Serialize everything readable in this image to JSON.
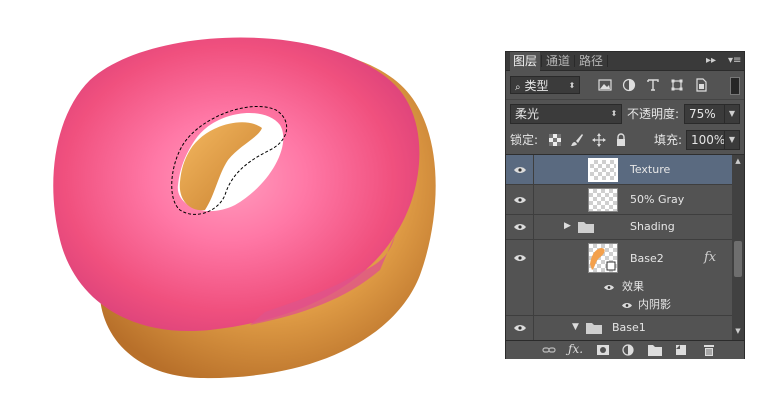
{
  "panel": {
    "tabs": [
      {
        "label": "图层",
        "active": true
      },
      {
        "label": "通道",
        "active": false
      },
      {
        "label": "路径",
        "active": false
      }
    ],
    "filter": {
      "label": "类型"
    },
    "blend_mode": {
      "value": "柔光"
    },
    "opacity": {
      "label": "不透明度:",
      "value": "75%"
    },
    "lock": {
      "label": "锁定:"
    },
    "fill": {
      "label": "填充:",
      "value": "100%"
    },
    "layers": [
      {
        "name": "Texture",
        "selected": true
      },
      {
        "name": "50% Gray",
        "selected": false
      },
      {
        "name": "Shading",
        "type": "group"
      },
      {
        "name": "Base2",
        "fx": "fx"
      },
      {
        "name": "效果",
        "type": "effects"
      },
      {
        "name": "内阴影",
        "type": "effect"
      },
      {
        "name": "Base1",
        "type": "group"
      }
    ]
  },
  "colors": {
    "panel_bg": "#535353",
    "selected_layer": "#5a6a80",
    "frosting": "#f0608a",
    "dough": "#d99740"
  },
  "icons": [
    "search-icon",
    "image-filter-icon",
    "adjustment-filter-icon",
    "type-filter-icon",
    "shape-filter-icon",
    "smart-object-filter-icon",
    "eye-icon",
    "lock-transparency-icon",
    "lock-brush-icon",
    "lock-move-icon",
    "lock-all-icon",
    "folder-icon",
    "link-icon",
    "fx-icon",
    "mask-icon",
    "new-adjustment-icon",
    "new-group-icon",
    "new-layer-icon",
    "trash-icon"
  ]
}
